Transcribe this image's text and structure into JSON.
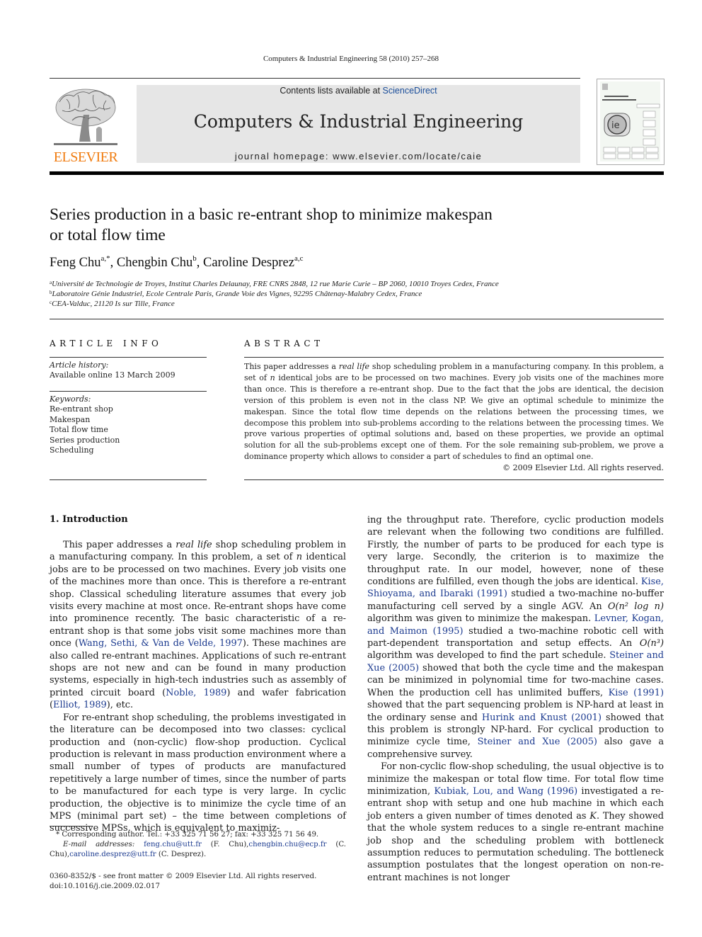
{
  "running_head": "Computers & Industrial Engineering 58 (2010) 257–268",
  "masthead": {
    "contents_prefix": "Contents lists available at ",
    "contents_link": "ScienceDirect",
    "journal_title": "Computers & Industrial Engineering",
    "homepage": "journal homepage: www.elsevier.com/locate/caie",
    "publisher_wordmark": "ELSEVIER",
    "brand_color": "#f07c10",
    "link_color": "#1b4e9a"
  },
  "article": {
    "title_line1": "Series production in a basic re-entrant shop to minimize makespan",
    "title_line2": "or total flow time",
    "authors": [
      {
        "name": "Feng Chu",
        "sup": "a,*"
      },
      {
        "name": "Chengbin Chu",
        "sup": "b"
      },
      {
        "name": "Caroline Desprez",
        "sup": "a,c"
      }
    ],
    "affiliations": [
      {
        "sup": "a",
        "text": "Université de Technologie de Troyes, Institut Charles Delaunay, FRE CNRS 2848, 12 rue Marie Curie – BP 2060, 10010 Troyes Cedex, France"
      },
      {
        "sup": "b",
        "text": "Laboratoire Génie Industriel, Ecole Centrale Paris, Grande Voie des Vignes, 92295 Châtenay-Malabry Cedex, France"
      },
      {
        "sup": "c",
        "text": "CEA-Valduc, 21120 Is sur Tille, France"
      }
    ]
  },
  "article_info": {
    "heading": "ARTICLE INFO",
    "history_label": "Article history:",
    "history_value": "Available online 13 March 2009",
    "keywords_label": "Keywords:",
    "keywords": [
      "Re-entrant shop",
      "Makespan",
      "Total flow time",
      "Series production",
      "Scheduling"
    ]
  },
  "abstract": {
    "heading": "ABSTRACT",
    "seg1": "This paper addresses a ",
    "seg1_italic": "real life",
    "seg2": " shop scheduling problem in a manufacturing company. In this problem, a set of ",
    "seg2_italic": "n",
    "seg3": " identical jobs are to be processed on two machines. Every job visits one of the machines more than once. This is therefore a re-entrant shop. Due to the fact that the jobs are identical, the decision version of this problem is even not in the class NP. We give an optimal schedule to minimize the makespan. Since the total flow time depends on the relations between the processing times, we decompose this problem into sub-problems according to the relations between the processing times. We prove various properties of optimal solutions and, based on these properties, we provide an optimal solution for all the sub-problems except one of them. For the sole remaining sub-problem, we prove a dominance property which allows to consider a part of schedules to find an optimal one.",
    "copyright": "© 2009 Elsevier Ltd. All rights reserved."
  },
  "introduction": {
    "heading": "1. Introduction",
    "p1": {
      "a": "This paper addresses a ",
      "a_i": "real life",
      "b": " shop scheduling problem in a manufacturing company. In this problem, a set of ",
      "b_i": "n",
      "c": " identical jobs are to be processed on two machines. Every job visits one of the machines more than once. This is therefore a re-entrant shop. Classical scheduling literature assumes that every job visits every machine at most once. Re-entrant shops have come into prominence recently. The basic characteristic of a re-entrant shop is that some jobs visit some machines more than once (",
      "ref1": "Wang, Sethi, & Van de Velde, 1997",
      "d": "). These machines are also called re-entrant machines. Applications of such re-entrant shops are not new and can be found in many production systems, especially in high-tech industries such as assembly of printed circuit board (",
      "ref2": "Noble, 1989",
      "e": ") and wafer fabrication (",
      "ref3": "Elliot, 1989",
      "f": "), etc."
    },
    "p2": "For re-entrant shop scheduling, the problems investigated in the literature can be decomposed into two classes: cyclical production and (non-cyclic) flow-shop production. Cyclical production is relevant in mass production environment where a small number of types of products are manufactured repetitively a large number of times, since the number of parts to be manufactured for each type is very large. In cyclic production, the objective is to minimize the cycle time of an MPS (minimal part set) – the time between completions of successive MPSs, which is equivalent to maximiz-",
    "p3": {
      "a": "ing the throughput rate. Therefore, cyclic production models are relevant when the following two conditions are fulfilled. Firstly, the number of parts to be produced for each type is very large. Secondly, the criterion is to maximize the throughput rate. In our model, however, none of these conditions are fulfilled, even though the jobs are identical. ",
      "ref1": "Kise, Shioyama, and Ibaraki (1991)",
      "b": " studied a two-machine no-buffer manufacturing cell served by a single AGV. An ",
      "math1": "O(n² log n)",
      "c": " algorithm was given to minimize the makespan. ",
      "ref2": "Levner, Kogan, and Maimon (1995)",
      "d": " studied a two-machine robotic cell with part-dependent transportation and setup effects. An ",
      "math2": "O(n³)",
      "e": " algorithm was developed to find the part schedule. ",
      "ref3": "Steiner and Xue (2005)",
      "f": " showed that both the cycle time and the makespan can be minimized in polynomial time for two-machine cases. When the production cell has unlimited buffers, ",
      "ref4": "Kise (1991)",
      "g": " showed that the part sequencing problem is NP-hard at least in the ordinary sense and ",
      "ref5": "Hurink and Knust (2001)",
      "h": " showed that this problem is strongly NP-hard. For cyclical production to minimize cycle time, ",
      "ref6": "Steiner and Xue (2005)",
      "i": " also gave a comprehensive survey."
    },
    "p4": {
      "a": "For non-cyclic flow-shop scheduling, the usual objective is to minimize the makespan or total flow time. For total flow time minimization, ",
      "ref1": "Kubiak, Lou, and Wang (1996)",
      "b": " investigated a re-entrant shop with setup and one hub machine in which each job enters a given number of times denoted as ",
      "b_i": "K",
      "c": ". They showed that the whole system reduces to a single re-entrant machine job shop and the scheduling problem with bottleneck assumption reduces to permutation scheduling. The bottleneck assumption postulates that the longest operation on non-re-entrant machines is not longer"
    }
  },
  "footnotes": {
    "corresponding": "* Corresponding author. Tel.: +33 325 71 56 27; fax: +33 325 71 56 49.",
    "email_label": "E-mail addresses:",
    "emails": [
      {
        "addr": "feng.chu@utt.fr",
        "who": " (F. Chu),"
      },
      {
        "addr": "chengbin.chu@ecp.fr",
        "who": " (C. Chu),"
      },
      {
        "addr": "caroline.desprez@utt.fr",
        "who": " (C. Desprez)."
      }
    ]
  },
  "front_matter": {
    "issn_line": "0360-8352/$ - see front matter © 2009 Elsevier Ltd. All rights reserved.",
    "doi": "doi:10.1016/j.cie.2009.02.017"
  }
}
